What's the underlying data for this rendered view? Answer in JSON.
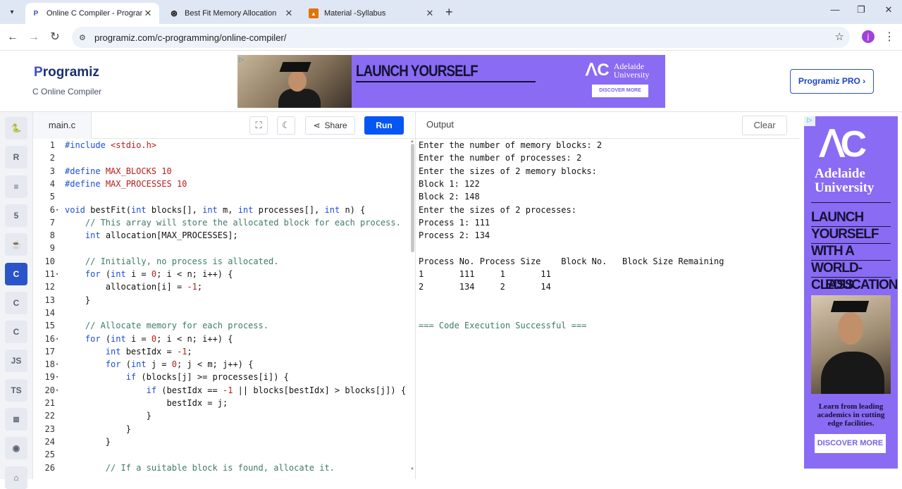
{
  "browser": {
    "tabs": [
      {
        "title": "Online C Compiler - Programiz",
        "favicon": "programiz-icon",
        "active": true
      },
      {
        "title": "Best Fit Memory Allocation",
        "favicon": "openai-icon",
        "active": false
      },
      {
        "title": "Material -Syllabus",
        "favicon": "classroom-icon",
        "active": false
      }
    ],
    "url": "programiz.com/c-programming/online-compiler/",
    "profile_initial": "j"
  },
  "site": {
    "logo_p": "P",
    "logo_rest": "rogramiz",
    "subtitle": "C Online Compiler",
    "pro_button": "Programiz PRO ›",
    "ad_banner": {
      "headline": "LAUNCH YOURSELF",
      "university_line1": "Adelaide",
      "university_line2": "University",
      "cta": "DISCOVER MORE"
    }
  },
  "editor": {
    "file_tab": "main.c",
    "share_label": "Share",
    "run_label": "Run",
    "lines": [
      {
        "n": "1",
        "fold": "",
        "html": "<span class='k'>#include</span> <span class='s'>&lt;stdio.h&gt;</span>"
      },
      {
        "n": "2",
        "fold": "",
        "html": ""
      },
      {
        "n": "3",
        "fold": "",
        "html": "<span class='k'>#define</span> <span class='n'>MAX_BLOCKS 10</span>"
      },
      {
        "n": "4",
        "fold": "",
        "html": "<span class='k'>#define</span> <span class='n'>MAX_PROCESSES 10</span>"
      },
      {
        "n": "5",
        "fold": "",
        "html": ""
      },
      {
        "n": "6",
        "fold": "▾",
        "html": "<span class='k'>void</span> bestFit(<span class='k'>int</span> blocks[], <span class='k'>int</span> m, <span class='k'>int</span> processes[], <span class='k'>int</span> n) {"
      },
      {
        "n": "7",
        "fold": "",
        "html": "    <span class='c'>// This array will store the allocated block for each process.</span>"
      },
      {
        "n": "8",
        "fold": "",
        "html": "    <span class='k'>int</span> allocation[MAX_PROCESSES];"
      },
      {
        "n": "9",
        "fold": "",
        "html": ""
      },
      {
        "n": "10",
        "fold": "",
        "html": "    <span class='c'>// Initially, no process is allocated.</span>"
      },
      {
        "n": "11",
        "fold": "▾",
        "html": "    <span class='k'>for</span> (<span class='k'>int</span> i = <span class='n'>0</span>; i &lt; n; i++) {"
      },
      {
        "n": "12",
        "fold": "",
        "html": "        allocation[i] = <span class='n'>-1</span>;"
      },
      {
        "n": "13",
        "fold": "",
        "html": "    }"
      },
      {
        "n": "14",
        "fold": "",
        "html": ""
      },
      {
        "n": "15",
        "fold": "",
        "html": "    <span class='c'>// Allocate memory for each process.</span>"
      },
      {
        "n": "16",
        "fold": "▾",
        "html": "    <span class='k'>for</span> (<span class='k'>int</span> i = <span class='n'>0</span>; i &lt; n; i++) {"
      },
      {
        "n": "17",
        "fold": "",
        "html": "        <span class='k'>int</span> bestIdx = <span class='n'>-1</span>;"
      },
      {
        "n": "18",
        "fold": "▾",
        "html": "        <span class='k'>for</span> (<span class='k'>int</span> j = <span class='n'>0</span>; j &lt; m; j++) {"
      },
      {
        "n": "19",
        "fold": "▾",
        "html": "            <span class='k'>if</span> (blocks[j] &gt;= processes[i]) {"
      },
      {
        "n": "20",
        "fold": "▾",
        "html": "                <span class='k'>if</span> (bestIdx == <span class='n'>-1</span> || blocks[bestIdx] &gt; blocks[j]) {"
      },
      {
        "n": "21",
        "fold": "",
        "html": "                    bestIdx = j;"
      },
      {
        "n": "22",
        "fold": "",
        "html": "                }"
      },
      {
        "n": "23",
        "fold": "",
        "html": "            }"
      },
      {
        "n": "24",
        "fold": "",
        "html": "        }"
      },
      {
        "n": "25",
        "fold": "",
        "html": ""
      },
      {
        "n": "26",
        "fold": "",
        "html": "        <span class='c'>// If a suitable block is found, allocate it.</span>"
      }
    ]
  },
  "output": {
    "title": "Output",
    "clear_label": "Clear",
    "lines": [
      "Enter the number of memory blocks: 2",
      "Enter the number of processes: 2",
      "Enter the sizes of 2 memory blocks:",
      "Block 1: 122",
      "Block 2: 148",
      "Enter the sizes of 2 processes:",
      "Process 1: 111",
      "Process 2: 134",
      "",
      "Process No. Process Size    Block No.   Block Size Remaining",
      "1       111     1       11",
      "2       134     2       14",
      "",
      "",
      "=== Code Execution Successful ==="
    ]
  },
  "rail": [
    {
      "name": "python",
      "glyph": "🐍",
      "active": false
    },
    {
      "name": "r",
      "glyph": "R",
      "active": false
    },
    {
      "name": "sql",
      "glyph": "≡",
      "active": false
    },
    {
      "name": "html",
      "glyph": "5",
      "active": false
    },
    {
      "name": "java",
      "glyph": "☕",
      "active": false
    },
    {
      "name": "c",
      "glyph": "C",
      "active": true
    },
    {
      "name": "cpp",
      "glyph": "C",
      "active": false
    },
    {
      "name": "csharp",
      "glyph": "C",
      "active": false
    },
    {
      "name": "js",
      "glyph": "JS",
      "active": false
    },
    {
      "name": "ts",
      "glyph": "TS",
      "active": false
    },
    {
      "name": "go",
      "glyph": "≣",
      "active": false
    },
    {
      "name": "php",
      "glyph": "◉",
      "active": false
    },
    {
      "name": "swift",
      "glyph": "⌂",
      "active": false
    }
  ],
  "side_ad": {
    "university_line1": "Adelaide",
    "university_line2": "University",
    "headline": [
      "LAUNCH",
      "YOURSELF",
      "WITH A",
      "WORLD-CLASS",
      "EDUCATION"
    ],
    "blurb": "Learn from leading academics in cutting edge facilities.",
    "cta": "DISCOVER MORE"
  },
  "colors": {
    "accent": "#0556f3",
    "ad_purple": "#8a6bf3",
    "tab_bar": "#dfe7f5"
  }
}
